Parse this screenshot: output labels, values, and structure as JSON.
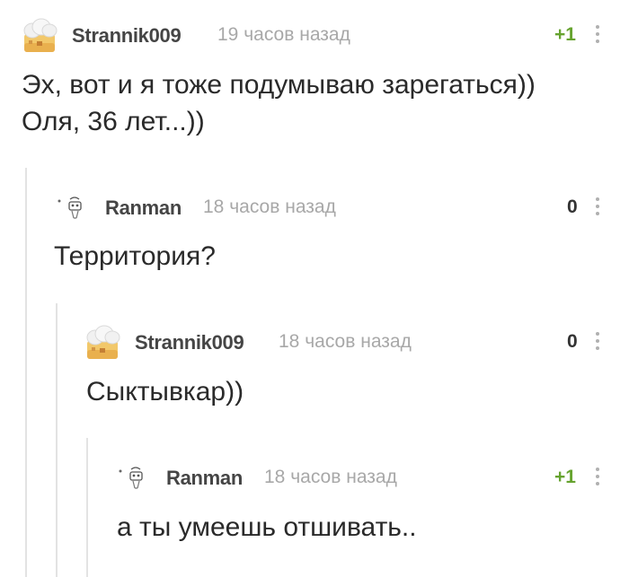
{
  "comments": [
    {
      "username": "Strannik009",
      "time": "19 часов назад",
      "rating": "+1",
      "text_lines": [
        "Эх, вот и я тоже подумываю зарегаться))",
        "Оля, 36 лет...))"
      ],
      "avatar": "hat-house-avatar"
    },
    {
      "username": "Ranman",
      "time": "18 часов назад",
      "rating": "0",
      "text_lines": [
        "Территория?"
      ],
      "avatar": "doodle-avatar"
    },
    {
      "username": "Strannik009",
      "time": "18 часов назад",
      "rating": "0",
      "text_lines": [
        "Сыктывкар))"
      ],
      "avatar": "hat-house-avatar"
    },
    {
      "username": "Ranman",
      "time": "18 часов назад",
      "rating": "+1",
      "text_lines": [
        "а ты умеешь отшивать.."
      ],
      "avatar": "doodle-avatar"
    }
  ],
  "colors": {
    "positive_rating": "#66a32f",
    "username": "#454545",
    "timestamp": "#a8a8a8",
    "thread_line": "#e3e3e3"
  }
}
